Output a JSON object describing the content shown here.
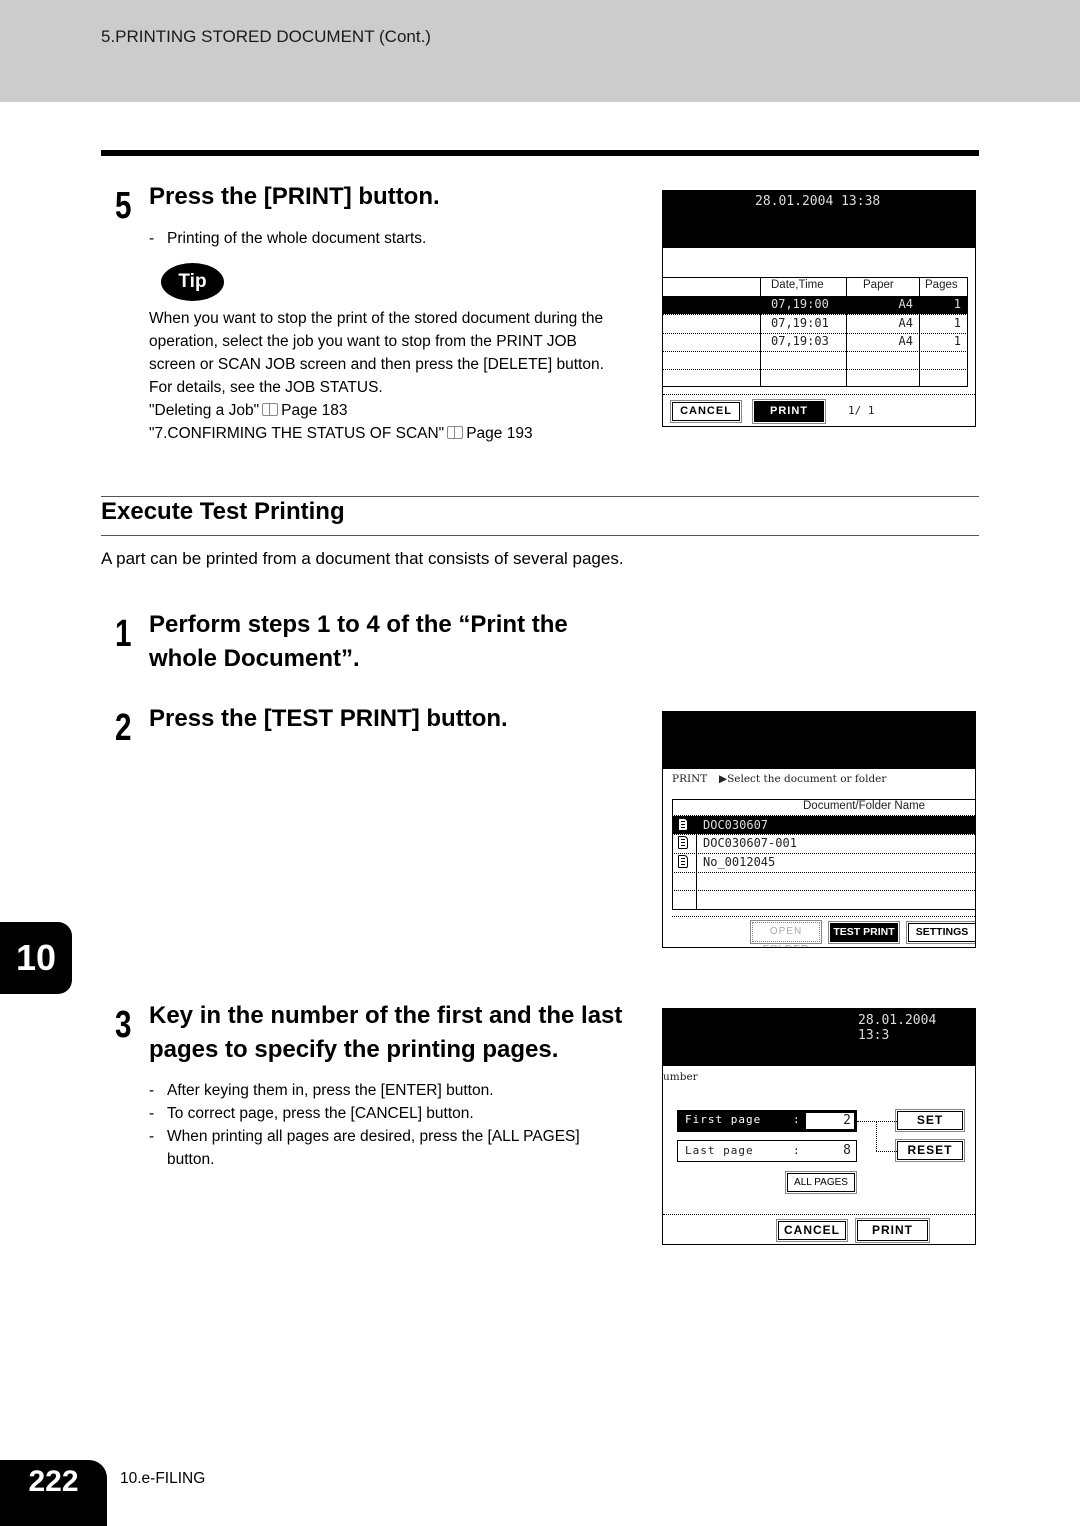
{
  "header": {
    "title": "5.PRINTING STORED DOCUMENT (Cont.)"
  },
  "step5": {
    "number": "5",
    "title": "Press the [PRINT] button.",
    "bullets": [
      "Printing of the whole document starts."
    ],
    "tip_label": "Tip",
    "tip_lines": [
      "When you want to stop the print of the stored document during the",
      "operation, select the job you want to stop from the PRINT JOB",
      "screen or SCAN JOB screen and then press the [DELETE] button.",
      "For details, see the JOB STATUS."
    ],
    "refs": [
      {
        "title": "\"Deleting a Job\"",
        "page": "Page 183",
        "icon": "book-icon"
      },
      {
        "title": "\"7.CONFIRMING THE STATUS OF SCAN\"",
        "page": "Page 193",
        "icon": "book-icon"
      }
    ]
  },
  "section": {
    "title": "Execute Test Printing",
    "intro": "A part can be printed from a document that consists of several pages."
  },
  "step1": {
    "number": "1",
    "title_line1": "Perform steps 1 to 4 of the “Print the",
    "title_line2": "whole Document”."
  },
  "step2": {
    "number": "2",
    "title": "Press the [TEST PRINT] button."
  },
  "step3": {
    "number": "3",
    "title_line1": "Key in the number of the first and the last",
    "title_line2": "pages to specify the printing pages.",
    "bullets": [
      "After keying them in, press the [ENTER] button.",
      "To correct page, press the [CANCEL] button.",
      "When printing all pages are desired, press the [ALL PAGES]",
      "button."
    ]
  },
  "screen1": {
    "datetime": "28.01.2004 13:38",
    "columns": [
      "Date,Time",
      "Paper",
      "Pages"
    ],
    "rows": [
      {
        "datetime": "07,19:00",
        "paper": "A4",
        "pages": "1",
        "selected": true
      },
      {
        "datetime": "07,19:01",
        "paper": "A4",
        "pages": "1",
        "selected": false
      },
      {
        "datetime": "07,19:03",
        "paper": "A4",
        "pages": "1",
        "selected": false
      }
    ],
    "buttons": {
      "cancel": "CANCEL",
      "print": "PRINT"
    },
    "page_indicator": "1/  1"
  },
  "screen2": {
    "mode": "PRINT",
    "instruction": "▶Select the document or folder",
    "column": "Document/Folder Name",
    "rows": [
      {
        "name": "DOC030607",
        "selected": true,
        "icon": "document-icon"
      },
      {
        "name": "DOC030607-001",
        "selected": false,
        "icon": "document-icon"
      },
      {
        "name": "No_0012045",
        "selected": false,
        "icon": "document-icon"
      }
    ],
    "buttons": {
      "open_folder": "OPEN FOLDER",
      "test_print": "TEST PRINT",
      "settings": "SETTINGS"
    }
  },
  "screen3": {
    "datetime": "28.01.2004 13:3",
    "label": "umber",
    "first_page_label": "First page",
    "first_page_value": "2",
    "last_page_label": "Last page",
    "last_page_value": "8",
    "separator": ":",
    "buttons": {
      "set": "SET",
      "reset": "RESET",
      "all_pages": "ALL PAGES",
      "cancel": "CANCEL",
      "print": "PRINT"
    }
  },
  "chapter_tab": "10",
  "footer": {
    "page_number": "222",
    "chapter": "10.e-FILING"
  }
}
